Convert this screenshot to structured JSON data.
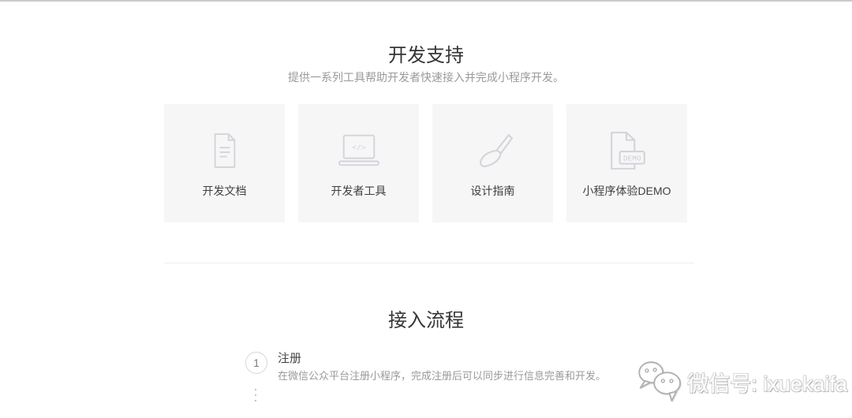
{
  "support_section": {
    "title": "开发支持",
    "subtitle": "提供一系列工具帮助开发者快速接入并完成小程序开发。",
    "cards": [
      {
        "label": "开发文档"
      },
      {
        "label": "开发者工具",
        "code_glyph": "</>"
      },
      {
        "label": "设计指南"
      },
      {
        "label": "小程序体验DEMO",
        "badge": "DEMO"
      }
    ]
  },
  "process_section": {
    "title": "接入流程",
    "steps": [
      {
        "number": "1",
        "title": "注册",
        "description": "在微信公众平台注册小程序，完成注册后可以同步进行信息完善和开发。"
      }
    ]
  },
  "watermark": {
    "label": "微信号: ixuekaifa"
  },
  "colors": {
    "card_background": "#f6f6f7",
    "icon_stroke": "#d2d4da",
    "heading_text": "#353535",
    "muted_text": "#9a9a9a",
    "divider": "#ededed"
  }
}
